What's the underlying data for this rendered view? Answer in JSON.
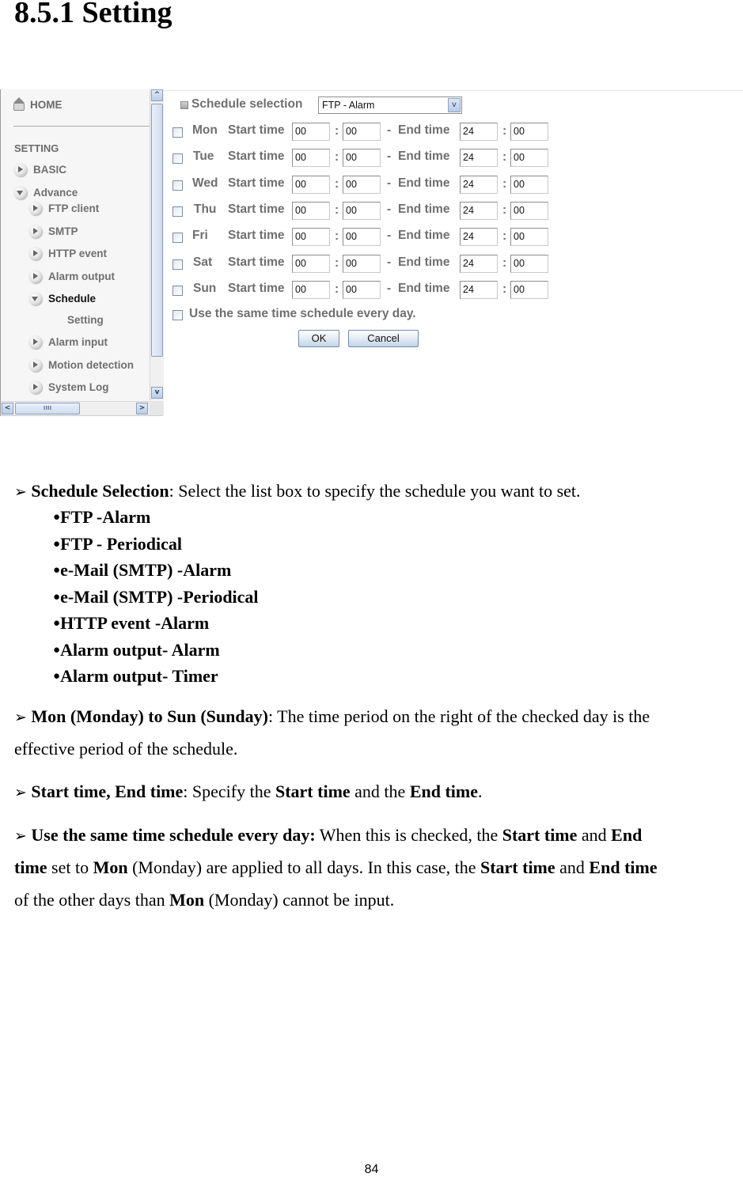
{
  "heading": "8.5.1 Setting",
  "sidebar": {
    "home_label": "HOME",
    "setting_header": "SETTING",
    "items": [
      {
        "label": "BASIC",
        "state": "collapsed",
        "level": 1
      },
      {
        "label": "Advance",
        "state": "expanded",
        "level": 1
      },
      {
        "label": "FTP client",
        "state": "collapsed",
        "level": 2
      },
      {
        "label": "SMTP",
        "state": "collapsed",
        "level": 2
      },
      {
        "label": "HTTP event",
        "state": "collapsed",
        "level": 2
      },
      {
        "label": "Alarm output",
        "state": "collapsed",
        "level": 2
      },
      {
        "label": "Schedule",
        "state": "expanded",
        "level": 2,
        "active": true
      },
      {
        "label": "Setting",
        "state": "leaf",
        "level": 3
      },
      {
        "label": "Alarm input",
        "state": "collapsed",
        "level": 2
      },
      {
        "label": "Motion detection",
        "state": "collapsed",
        "level": 2
      },
      {
        "label": "System Log",
        "state": "collapsed",
        "level": 2
      }
    ],
    "scroll_up_icon": "^",
    "scroll_down_icon": "v",
    "scroll_left_icon": "<",
    "scroll_right_icon": ">",
    "hthumb_grip": "IIII"
  },
  "form": {
    "schedule_selection_label": "Schedule selection",
    "schedule_selection_value": "FTP - Alarm",
    "dropdown_arrow": "v",
    "start_label": "Start time",
    "end_label": "End time",
    "colon": ":",
    "dash": "-",
    "days": [
      {
        "day": "Mon",
        "start_h": "00",
        "start_m": "00",
        "end_h": "24",
        "end_m": "00",
        "checked": false
      },
      {
        "day": "Tue",
        "start_h": "00",
        "start_m": "00",
        "end_h": "24",
        "end_m": "00",
        "checked": false
      },
      {
        "day": "Wed",
        "start_h": "00",
        "start_m": "00",
        "end_h": "24",
        "end_m": "00",
        "checked": false
      },
      {
        "day": "Thu",
        "start_h": "00",
        "start_m": "00",
        "end_h": "24",
        "end_m": "00",
        "checked": false
      },
      {
        "day": "Fri",
        "start_h": "00",
        "start_m": "00",
        "end_h": "24",
        "end_m": "00",
        "checked": false
      },
      {
        "day": "Sat",
        "start_h": "00",
        "start_m": "00",
        "end_h": "24",
        "end_m": "00",
        "checked": false
      },
      {
        "day": "Sun",
        "start_h": "00",
        "start_m": "00",
        "end_h": "24",
        "end_m": "00",
        "checked": false
      }
    ],
    "same_schedule_label": "Use the same time schedule every day.",
    "same_schedule_checked": false,
    "ok_label": "OK",
    "cancel_label": "Cancel"
  },
  "doc": {
    "arrow": "➢",
    "p1": {
      "bold": "Schedule Selection",
      "text": ": Select the list box to specify the schedule you want to set."
    },
    "bullet": "●",
    "options": [
      "FTP -Alarm",
      "FTP - Periodical",
      "e-Mail (SMTP) -Alarm",
      "e-Mail (SMTP) -Periodical",
      "HTTP event -Alarm",
      "Alarm output- Alarm",
      "Alarm output- Timer"
    ],
    "p2": {
      "bold": "Mon (Monday) to Sun (Sunday)",
      "text": ": The time period on the right of the checked day is the",
      "line2": "effective period of the schedule."
    },
    "p3": {
      "bold": "Start time, End time",
      "t1": ": Specify the ",
      "b2": "Start time",
      "t2": " and the ",
      "b3": "End time",
      "t3": "."
    },
    "p4": {
      "bold": "Use the same time schedule every day:",
      "t1": " When this is checked, the ",
      "b2": "Start time",
      "t2": " and ",
      "b3": "End",
      "l2_b1": "time",
      "l2_t1": " set to ",
      "l2_b2": "Mon",
      "l2_t2": " (Monday) are applied to all days. In this case, the ",
      "l2_b3": "Start time",
      "l2_t3": " and ",
      "l2_b4": "End time",
      "l3_t1": "of the other days than ",
      "l3_b1": "Mon",
      "l3_t2": " (Monday) cannot be input."
    }
  },
  "page_number": "84"
}
